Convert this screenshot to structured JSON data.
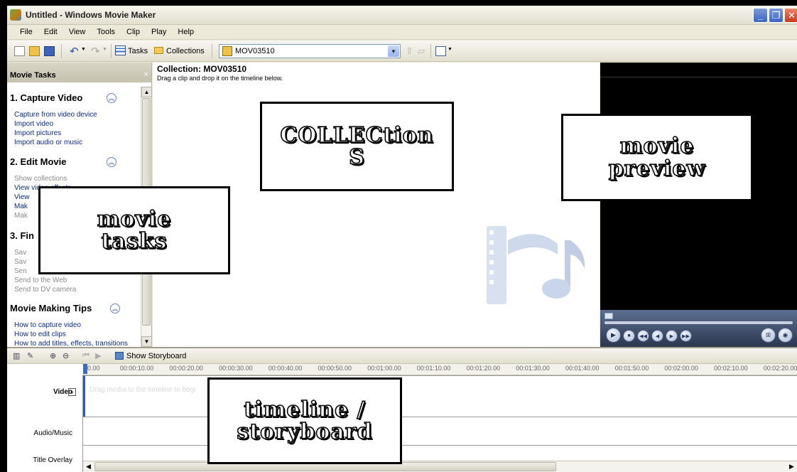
{
  "window": {
    "title": "Untitled - Windows Movie Maker"
  },
  "menubar": {
    "items": [
      "File",
      "Edit",
      "View",
      "Tools",
      "Clip",
      "Play",
      "Help"
    ]
  },
  "toolbar": {
    "tasks_label": "Tasks",
    "collections_label": "Collections",
    "collection_select_value": "MOV03510"
  },
  "tasks_pane": {
    "title": "Movie Tasks",
    "close_glyph": "×",
    "sections": [
      {
        "heading": "1. Capture Video",
        "links": [
          "Capture from video device",
          "Import video",
          "Import pictures",
          "Import audio or music"
        ]
      },
      {
        "heading": "2. Edit Movie",
        "links": [
          "Show collections",
          "View video effects",
          "View",
          "Mak",
          "Mak"
        ]
      },
      {
        "heading": "3. Fin",
        "links": [
          "Sav",
          "Sav",
          "Sen",
          "Send to the Web",
          "Send to DV camera"
        ]
      },
      {
        "heading": "Movie Making Tips",
        "links": [
          "How to capture video",
          "How to edit clips",
          "How to add titles, effects, transitions"
        ]
      }
    ]
  },
  "collections": {
    "title": "Collection: MOV03510",
    "hint": "Drag a clip and drop it on the timeline below."
  },
  "timeline": {
    "show_storyboard_label": "Show Storyboard",
    "ruler_ticks": [
      "0.00",
      "00:00:10.00",
      "00:00:20.00",
      "00:00:30.00",
      "00:00:40.00",
      "00:00:50.00",
      "00:01:00.00",
      "00:01:10.00",
      "00:01:20.00",
      "00:01:30.00",
      "00:01:40.00",
      "00:01:50.00",
      "00:02:00.00",
      "00:02:10.00",
      "00:02:20.00"
    ],
    "tracks": {
      "video": "Video",
      "audio": "Audio/Music",
      "title": "Title Overlay"
    },
    "drag_hint": "Drag media to the timeline to begi"
  },
  "annotations": {
    "collections": [
      "COLLECtion",
      "S"
    ],
    "movie_preview": [
      "movie",
      "preview"
    ],
    "movie_tasks": [
      "movie",
      "tasks"
    ],
    "timeline": [
      "timeline /",
      "storyboard"
    ]
  },
  "colors": {
    "link_blue": "#0a2b8c",
    "preview_bg": "#000000",
    "accent_blue": "#2c5fb4"
  }
}
